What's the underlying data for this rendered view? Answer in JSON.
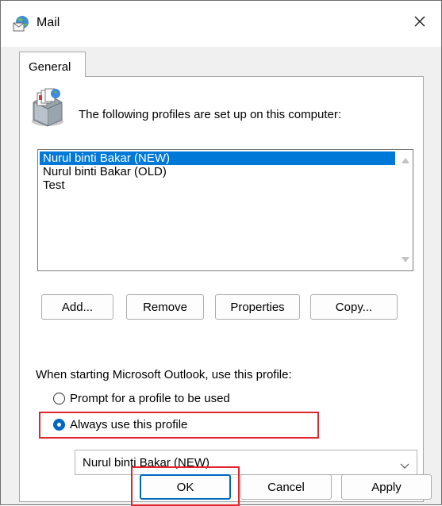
{
  "window": {
    "title": "Mail"
  },
  "tabs": [
    {
      "label": "General"
    }
  ],
  "general": {
    "intro": "The following profiles are set up on this computer:",
    "profiles": [
      {
        "name": "Nurul binti Bakar (NEW)",
        "selected": true
      },
      {
        "name": "Nurul binti Bakar (OLD)",
        "selected": false
      },
      {
        "name": "Test",
        "selected": false
      }
    ],
    "buttons": {
      "add": "Add...",
      "remove": "Remove",
      "properties": "Properties",
      "copy": "Copy..."
    },
    "startup_label": "When starting Microsoft Outlook, use this profile:",
    "options": {
      "prompt": {
        "label": "Prompt for a profile to be used",
        "checked": false
      },
      "always": {
        "label": "Always use this profile",
        "checked": true
      }
    },
    "selected_profile": "Nurul binti Bakar (NEW)"
  },
  "footer": {
    "ok": "OK",
    "cancel": "Cancel",
    "apply": "Apply"
  },
  "colors": {
    "selection": "#0078d7",
    "accent": "#0067c0",
    "highlight_annotation": "#e0262c",
    "dialog_background": "#f0f0f0"
  },
  "icons": {
    "app": "mail-globe-icon",
    "close": "close-icon",
    "profiles": "mail-profiles-icon",
    "dropdown": "chevron-down-icon"
  }
}
